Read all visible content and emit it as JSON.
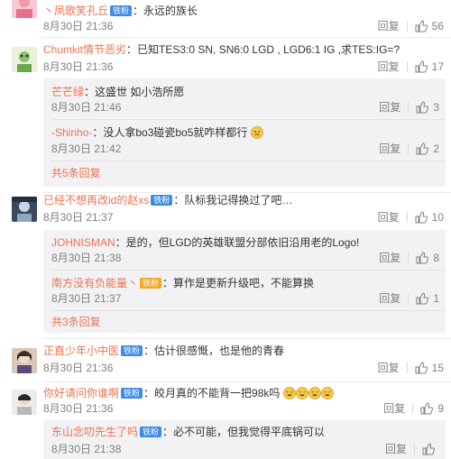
{
  "colors": {
    "accent": "#eb7350",
    "badge_blue": "#3e8be7",
    "meta": "#808080",
    "sub_bg": "#f2f2f5"
  },
  "labels": {
    "reply": "回复"
  },
  "comments": [
    {
      "user": "丶凤歌笑孔丘",
      "badge": "铁粉",
      "text": "：永远的族长",
      "time": "8月30日 21:36",
      "likes": "56",
      "avatar_icon": "pink-avatar"
    },
    {
      "user": "Chumkit情节恶劣",
      "badge": "",
      "text": "：已知TES3:0 SN, SN6:0 LGD , LGD6:1 IG ,求TES:IG=?",
      "time": "8月30日 21:36",
      "likes": "17",
      "avatar_icon": "green-avatar",
      "replies": [
        {
          "user": "芒芒绿",
          "badge": "",
          "text": "：这盛世 如小浩所愿",
          "time": "8月30日 21:46",
          "likes": "3"
        },
        {
          "user": "-Shinho-",
          "badge": "",
          "text": "：没人拿bo3碰瓷bo5就咋样都行",
          "emoji": "thinking-face-emoji",
          "time": "8月30日 21:42",
          "likes": "2"
        }
      ],
      "more": "共5条回复"
    },
    {
      "user": "已经不想再改id的赵xs",
      "badge": "铁粉",
      "text": "：队标我记得换过了吧…",
      "time": "8月30日 21:37",
      "likes": "10",
      "avatar_icon": "game-avatar",
      "replies": [
        {
          "user": "JOHNISMAN",
          "badge": "",
          "text": "：是的，但LGD的英雄联盟分部依旧沿用老的Logo!",
          "time": "8月30日 21:38",
          "likes": "8"
        },
        {
          "user": "南方没有负能量丶",
          "badge": "铁粉",
          "badge_gold": true,
          "text": "：算作是更新升级吧，不能算换",
          "time": "8月30日 21:37",
          "likes": "1"
        }
      ],
      "more": "共3条回复"
    },
    {
      "user": "正直少年小中医",
      "badge": "铁粉",
      "text": "：估计很感慨，也是他的青春",
      "time": "8月30日 21:36",
      "likes": "15",
      "avatar_icon": "girl-avatar"
    },
    {
      "user": "你好请问你谁啊",
      "badge": "铁粉",
      "text": "：皎月真的不能背一把98k吗",
      "emoji": "laughing-emoji",
      "time": "8月30日 21:36",
      "likes": "9",
      "avatar_icon": "person-avatar",
      "replies": [
        {
          "user": "东山念叨先生了吗",
          "badge": "铁粉",
          "text": "：必不可能，但我觉得平底锅可以",
          "time": "8月30日 21:38",
          "likes": ""
        }
      ]
    }
  ]
}
